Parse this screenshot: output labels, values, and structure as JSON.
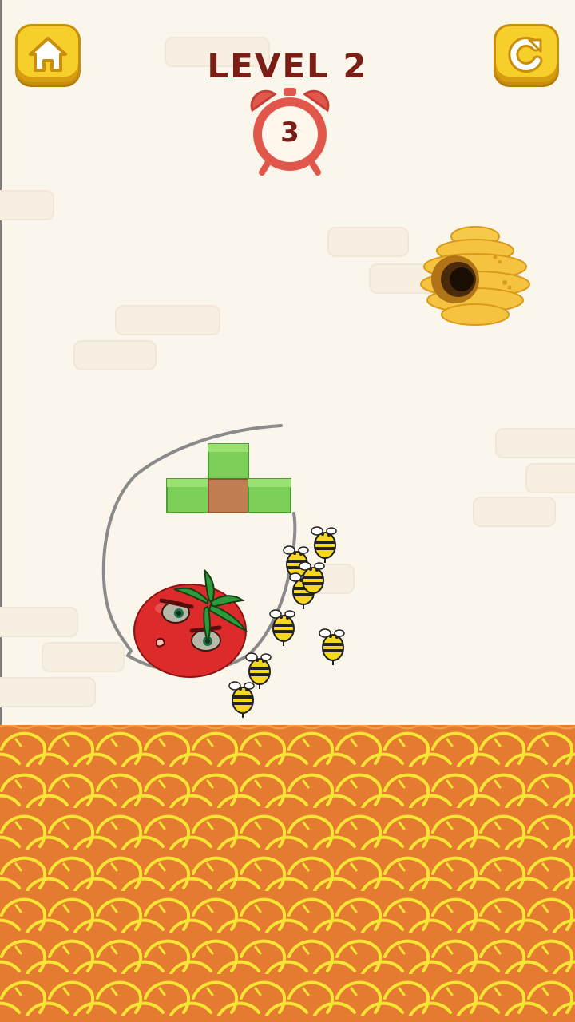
{
  "hud": {
    "level_label": "LEVEL 2",
    "timer_value": "3",
    "home_button": "home-icon",
    "restart_button": "restart-icon"
  },
  "scene": {
    "characters": [
      "tomato",
      "bee-swarm",
      "beehive"
    ],
    "bee_count": 8,
    "blocks": [
      "grass-block",
      "dirt-block"
    ],
    "ground": "honeycomb-lava"
  },
  "colors": {
    "background": "#fbf6ec",
    "button": "#f6cf2b",
    "title": "#7a1e16",
    "timer": "#e2574c",
    "grass": "#7cd05a",
    "dirt": "#c07e52",
    "tomato": "#dd2b2b",
    "honeycomb_base": "#e57b30",
    "honeycomb_line": "#f7e535"
  }
}
